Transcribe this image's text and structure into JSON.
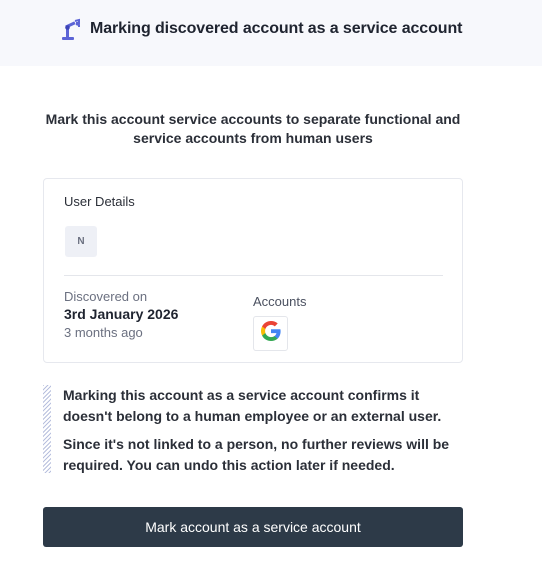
{
  "header": {
    "title": "Marking discovered account as a service account",
    "icon": "robot-arm-icon"
  },
  "intro": {
    "text": "Mark this account service accounts to separate functional and service accounts from human users"
  },
  "user_details": {
    "title": "User Details",
    "avatar_initial": "N",
    "discovered_label": "Discovered on",
    "discovered_date": "3rd January 2026",
    "discovered_ago": "3 months ago",
    "accounts_label": "Accounts",
    "accounts": [
      {
        "icon": "google-icon"
      }
    ]
  },
  "note": {
    "paragraph1": "Marking this account as a service account confirms it doesn't belong to a human employee or an external user.",
    "paragraph2": "Since it's not linked to a person, no further reviews will be required. You can undo this action later if needed."
  },
  "actions": {
    "primary_label": "Mark account as a service account"
  },
  "colors": {
    "header_bg": "#f7f8fc",
    "button_bg": "#2d3a48",
    "accent_icon": "#4f5bd5"
  }
}
